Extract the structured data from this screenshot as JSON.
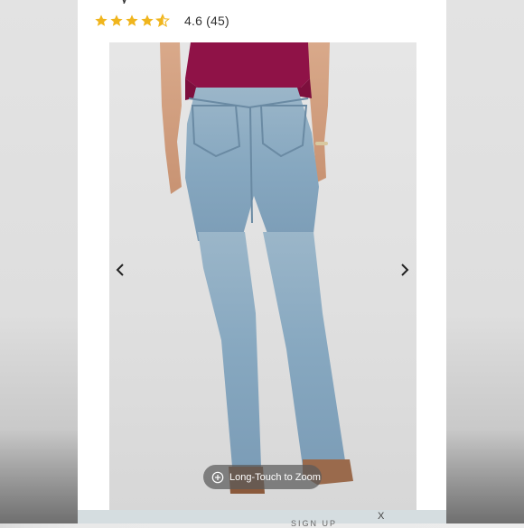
{
  "product": {
    "title_fragment": "y",
    "rating_value": "4.6",
    "review_count": "(45)",
    "rating_stars": 4.6
  },
  "gallery": {
    "zoom_hint": "Long-Touch to Zoom",
    "prev_icon": "chevron-left-icon",
    "next_icon": "chevron-right-icon"
  },
  "banner": {
    "close_label": "X",
    "partial_text": "SIGN UP"
  },
  "colors": {
    "star": "#f0b51d",
    "top_fabric": "#8f1247",
    "denim": "#8fb0c8"
  }
}
